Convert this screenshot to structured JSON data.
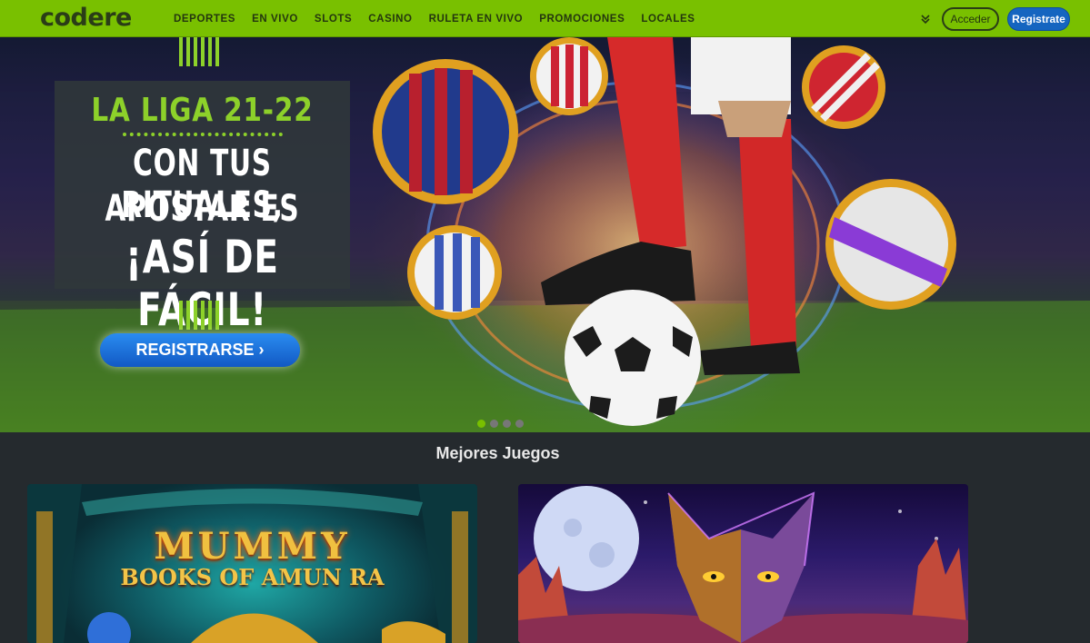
{
  "brand": {
    "logo_text": "codere",
    "accent": "#79c000",
    "primary_button": "#1565c0"
  },
  "nav": {
    "items": [
      "DEPORTES",
      "EN VIVO",
      "SLOTS",
      "CASINO",
      "RULETA EN VIVO",
      "PROMOCIONES",
      "LOCALES"
    ],
    "more_icon": "chevron-double-down-icon",
    "login_label": "Acceder",
    "register_label": "Registrate"
  },
  "hero": {
    "line1": "LA LIGA 21-22",
    "line2": "CON TUS RITUALES,",
    "line3": "APOSTAR ES",
    "line4": "¡ASÍ DE FÁCIL!",
    "cta_label": "REGISTRARSE ›",
    "slides_count": 4,
    "active_slide": 1
  },
  "games": {
    "title": "Mejores Juegos",
    "cards": [
      {
        "title": "MUMMY",
        "subtitle": "BOOKS OF AMUN RA"
      },
      {
        "title": "",
        "subtitle": ""
      }
    ]
  }
}
